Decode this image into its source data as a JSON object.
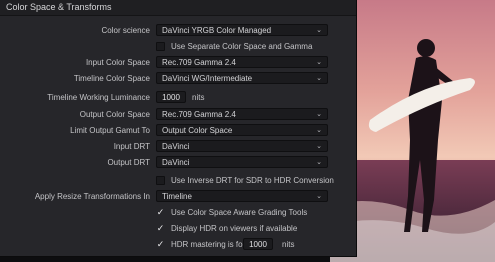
{
  "panel": {
    "title": "Color Space & Transforms"
  },
  "rows": {
    "color_science": {
      "label": "Color science",
      "value": "DaVinci YRGB Color Managed"
    },
    "separate_cs_gamma": {
      "label": "Use Separate Color Space and Gamma",
      "checked": false
    },
    "input_cs": {
      "label": "Input Color Space",
      "value": "Rec.709 Gamma 2.4"
    },
    "timeline_cs": {
      "label": "Timeline Color Space",
      "value": "DaVinci WG/Intermediate"
    },
    "working_luminance": {
      "label": "Timeline Working Luminance",
      "value": "1000",
      "unit": "nits"
    },
    "output_cs": {
      "label": "Output Color Space",
      "value": "Rec.709 Gamma 2.4"
    },
    "limit_gamut": {
      "label": "Limit Output Gamut To",
      "value": "Output Color Space"
    },
    "input_drt": {
      "label": "Input DRT",
      "value": "DaVinci"
    },
    "output_drt": {
      "label": "Output DRT",
      "value": "DaVinci"
    },
    "inverse_drt": {
      "label": "Use Inverse DRT for SDR to HDR Conversion",
      "checked": false
    },
    "resize_transforms": {
      "label": "Apply Resize Transformations In",
      "value": "Timeline"
    },
    "cs_aware_tools": {
      "label": "Use Color Space Aware Grading Tools",
      "checked": true
    },
    "display_hdr": {
      "label": "Display HDR on viewers if available",
      "checked": true
    },
    "hdr_mastering": {
      "label": "HDR mastering is for",
      "value": "1000",
      "unit": "nits",
      "checked": true
    }
  },
  "icons": {
    "dropdown": "chevron-down-icon",
    "check": "checkmark-icon"
  }
}
